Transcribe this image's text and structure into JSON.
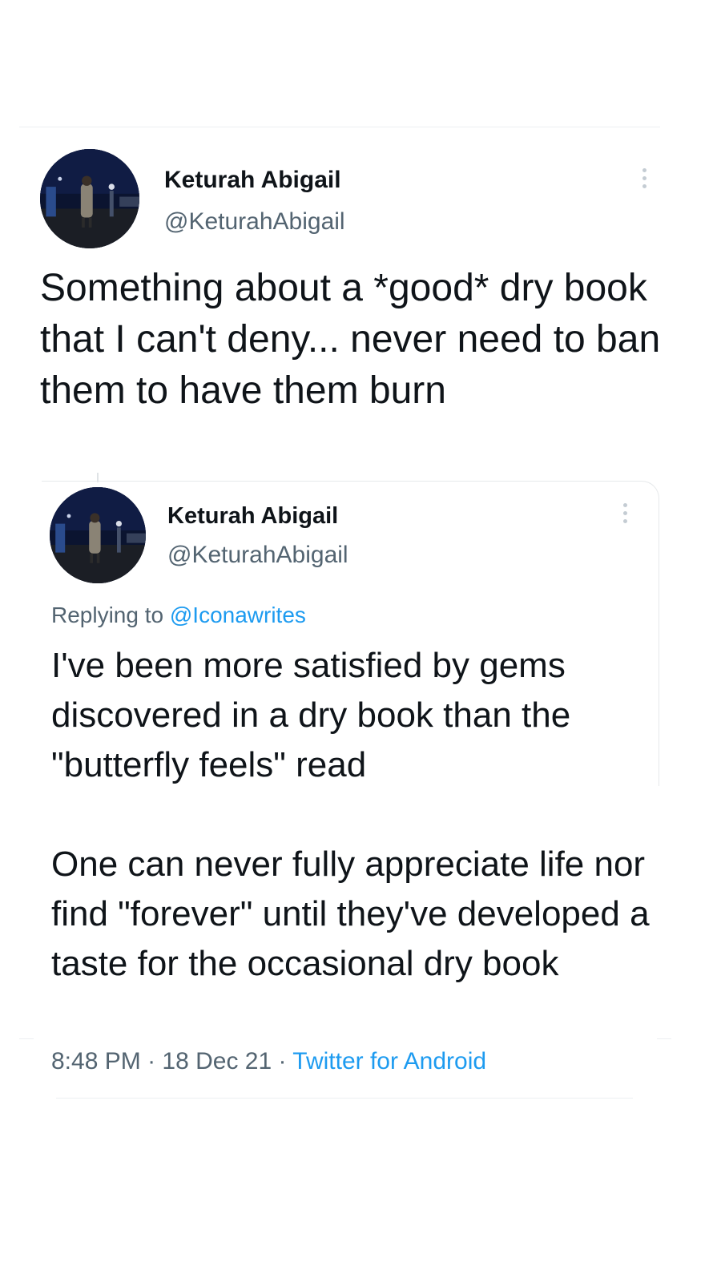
{
  "tweet": {
    "author_name": "Keturah Abigail",
    "author_handle": "@KeturahAbigail",
    "text": "Something about a *good* dry book that I can't deny... never need to ban them to have them burn"
  },
  "quoted": {
    "author_name": "Keturah Abigail",
    "author_handle": "@KeturahAbigail",
    "replying_prefix": "Replying to ",
    "replying_to": "@Iconawrites",
    "text": "I've been more satisfied by gems discovered in a dry book than the \"butterfly feels\" read\n\nOne can never fully appreciate life nor find \"forever\" until they've developed a taste for the occasional dry book"
  },
  "meta": {
    "time": "8:48 PM",
    "separator": " · ",
    "date": "18 Dec 21",
    "source": "Twitter for Android"
  },
  "icons": {
    "more": "more-vertical-icon",
    "avatar": "profile-photo"
  },
  "colors": {
    "link": "#1d9bf0",
    "secondary_text": "#536471",
    "primary_text": "#0f1419"
  }
}
